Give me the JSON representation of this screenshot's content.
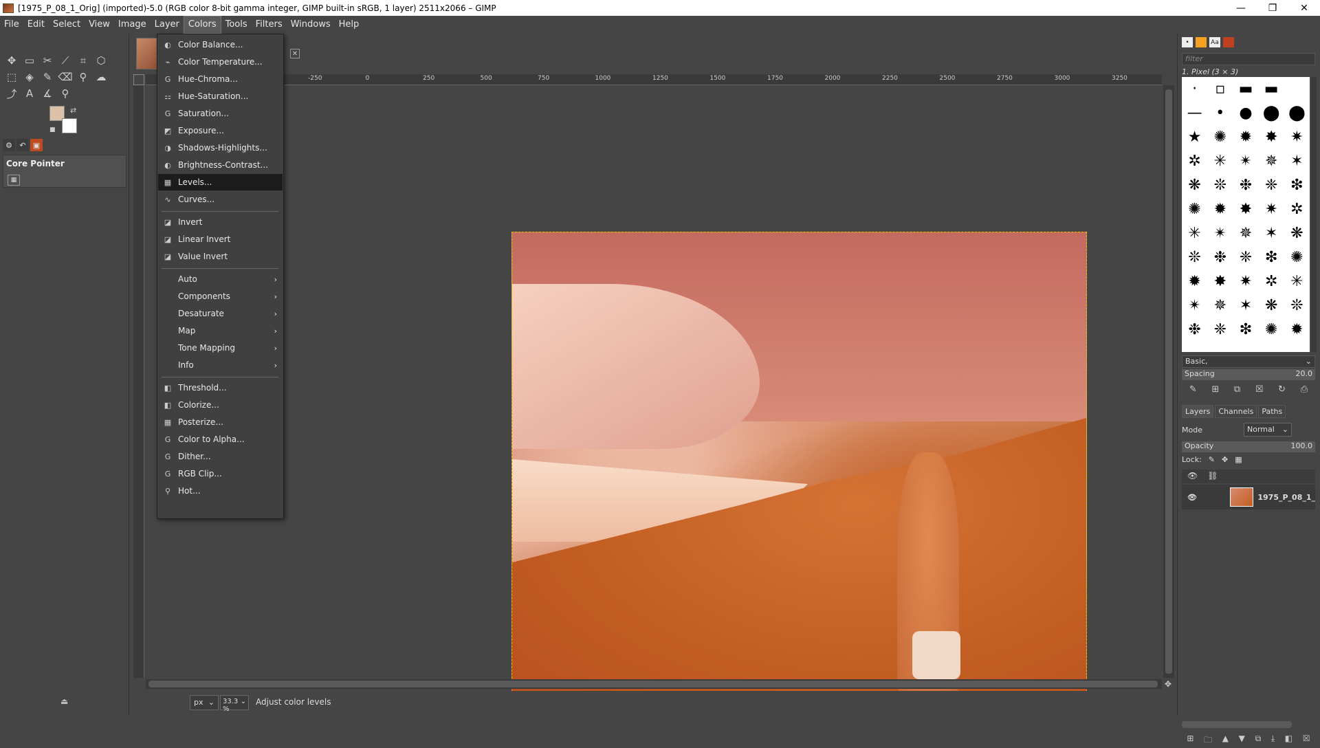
{
  "window": {
    "title": "[1975_P_08_1_Orig] (imported)-5.0 (RGB color 8-bit gamma integer, GIMP built-in sRGB, 1 layer) 2511x2066 – GIMP",
    "min": "—",
    "max": "❐",
    "close": "✕"
  },
  "menubar": [
    "File",
    "Edit",
    "Select",
    "View",
    "Image",
    "Layer",
    "Colors",
    "Tools",
    "Filters",
    "Windows",
    "Help"
  ],
  "colors_menu": {
    "items1": [
      "Color Balance...",
      "Color Temperature...",
      "Hue-Chroma...",
      "Hue-Saturation...",
      "Saturation...",
      "Exposure...",
      "Shadows-Highlights...",
      "Brightness-Contrast...",
      "Levels...",
      "Curves..."
    ],
    "items2": [
      "Invert",
      "Linear Invert",
      "Value Invert"
    ],
    "submenus": [
      "Auto",
      "Components",
      "Desaturate",
      "Map",
      "Tone Mapping",
      "Info"
    ],
    "items3": [
      "Threshold...",
      "Colorize...",
      "Posterize...",
      "Color to Alpha...",
      "Dither...",
      "RGB Clip...",
      "Hot..."
    ],
    "highlighted": "Levels..."
  },
  "tool_options": {
    "label": "Core Pointer"
  },
  "ruler_marks": [
    "-250",
    "0",
    "250",
    "500",
    "750",
    "1000",
    "1250",
    "1500",
    "1750",
    "2000",
    "2250",
    "2500",
    "2750",
    "3000",
    "3250"
  ],
  "status": {
    "unit": "px",
    "zoom": "33.3 %",
    "message": "Adjust color levels"
  },
  "brushes": {
    "filter_placeholder": "filter",
    "selected_name": "1. Pixel (3 × 3)",
    "preset": "Basic,",
    "spacing_label": "Spacing",
    "spacing_value": "20.0"
  },
  "layers": {
    "tabs": [
      "Layers",
      "Channels",
      "Paths"
    ],
    "mode_label": "Mode",
    "mode_value": "Normal",
    "opacity_label": "Opacity",
    "opacity_value": "100.0",
    "lock_label": "Lock:",
    "layer_name": "1975_P_08_1_"
  }
}
